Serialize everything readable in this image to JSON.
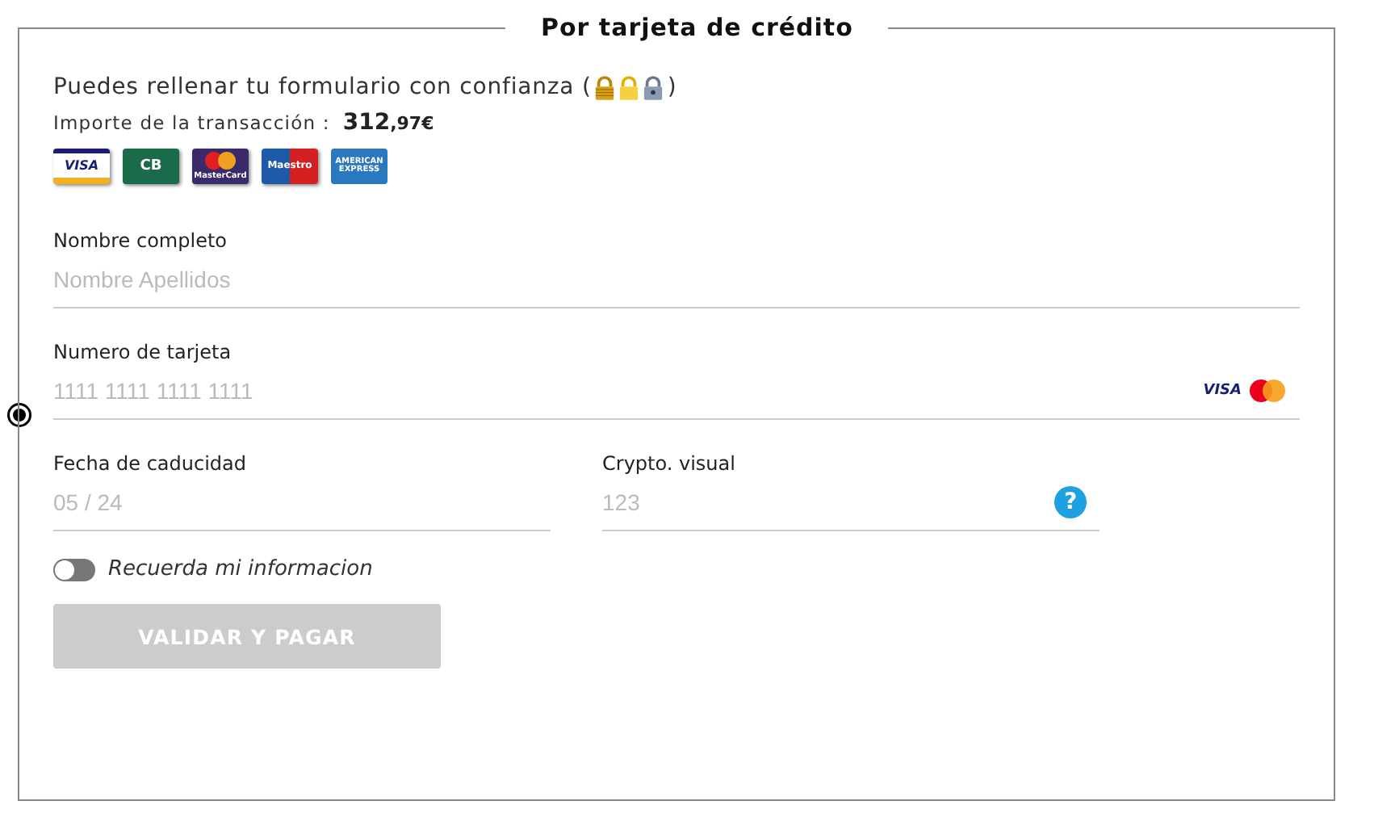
{
  "legend": "Por tarjeta de crédito",
  "trust_text": "Puedes rellenar tu formulario con confianza (",
  "trust_close": ")",
  "amount_label": "Importe de la transacción :",
  "amount_whole": "312",
  "amount_cents": ",97€",
  "card_logos": [
    {
      "kind": "visa",
      "label": "VISA"
    },
    {
      "kind": "cb",
      "label": "CB"
    },
    {
      "kind": "mastercard",
      "label": "MasterCard"
    },
    {
      "kind": "maestro",
      "label": "Maestro"
    },
    {
      "kind": "amex",
      "label": "AMERICAN EXPRESS"
    }
  ],
  "fields": [
    {
      "kind": "text",
      "label": "Nombre completo",
      "placeholder": "Nombre Apellidos"
    },
    {
      "kind": "card",
      "label": "Numero de tarjeta",
      "placeholder": "1111 1111 1111 1111",
      "brand": "VISA"
    }
  ],
  "half_fields": [
    {
      "kind": "date",
      "label": "Fecha de caducidad",
      "placeholder": "05 / 24"
    },
    {
      "kind": "cvv",
      "label": "Crypto. visual",
      "placeholder": "123",
      "help": "?"
    }
  ],
  "remember": {
    "label": "Recuerda mi informacion",
    "on": false
  },
  "submit": {
    "label": "VALIDAR Y PAGAR",
    "disabled": true
  }
}
